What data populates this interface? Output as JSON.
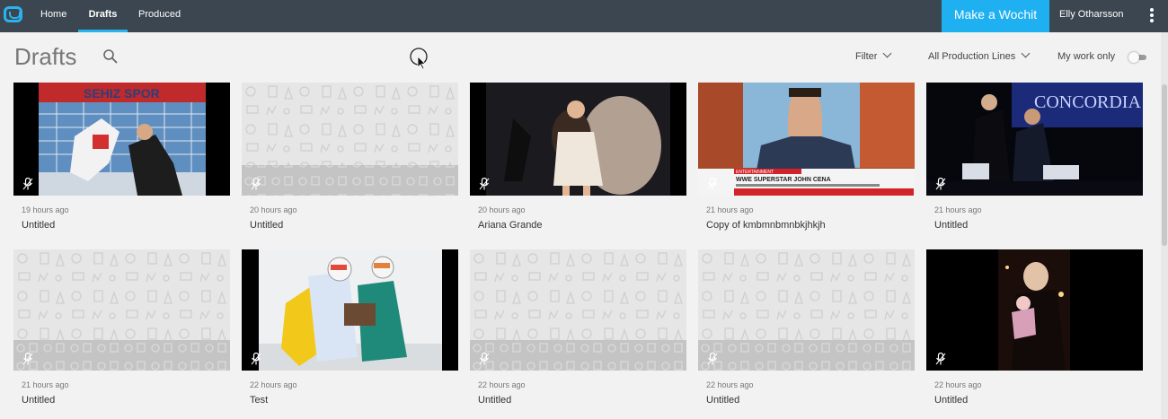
{
  "nav": {
    "items": [
      {
        "label": "Home",
        "active": false
      },
      {
        "label": "Drafts",
        "active": true
      },
      {
        "label": "Produced",
        "active": false
      }
    ],
    "make_button": "Make a Wochit",
    "user": "Elly Otharsson"
  },
  "header": {
    "title": "Drafts",
    "filter_label": "Filter",
    "production_lines_label": "All Production Lines",
    "my_work_label": "My work only"
  },
  "drafts": [
    {
      "time": "19 hours ago",
      "title": "Untitled",
      "thumb": "volleyball"
    },
    {
      "time": "20 hours ago",
      "title": "Untitled",
      "thumb": "placeholder"
    },
    {
      "time": "20 hours ago",
      "title": "Ariana Grande",
      "thumb": "performer"
    },
    {
      "time": "21 hours ago",
      "title": "Copy of kmbmnbmnbkjhkjh",
      "thumb": "interview"
    },
    {
      "time": "21 hours ago",
      "title": "Untitled",
      "thumb": "stage"
    },
    {
      "time": "21 hours ago",
      "title": "Untitled",
      "thumb": "placeholder"
    },
    {
      "time": "22 hours ago",
      "title": "Test",
      "thumb": "climbers"
    },
    {
      "time": "22 hours ago",
      "title": "Untitled",
      "thumb": "placeholder"
    },
    {
      "time": "22 hours ago",
      "title": "Untitled",
      "thumb": "placeholder"
    },
    {
      "time": "22 hours ago",
      "title": "Untitled",
      "thumb": "dark-portrait"
    }
  ],
  "overlay": {
    "banner_line1": "ENTERTAINMENT",
    "banner_line2": "WWE SUPERSTAR JOHN CENA",
    "stage_text": "CONCORDIA"
  },
  "colors": {
    "accent": "#29b3ef",
    "topbar": "#3c4650",
    "make_button": "#1eb0f0"
  }
}
